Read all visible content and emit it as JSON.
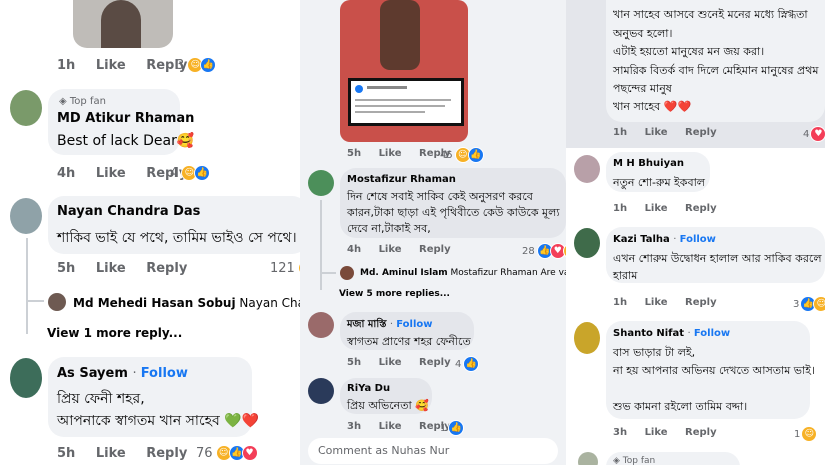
{
  "col1": {
    "top_meta": {
      "time": "1h",
      "like": "Like",
      "reply": "Reply",
      "count": "3"
    },
    "c1": {
      "badge": "Top fan",
      "name": "MD Atikur Rhaman",
      "text": "Best of lack Dear🥰",
      "time": "4h",
      "like": "Like",
      "reply": "Reply",
      "count": "4"
    },
    "c2": {
      "name": "Nayan Chandra Das",
      "text": "শাকিব ভাই যে পথে, তামিম ভাইও সে পথে। 😁",
      "time": "5h",
      "like": "Like",
      "reply": "Reply",
      "count": "121"
    },
    "reply_preview": {
      "name": "Md Mehedi Hasan Sobuj",
      "text": "Nayan Chandra Das y"
    },
    "more_replies": "View 1 more reply...",
    "c3": {
      "name": "As Sayem",
      "follow": "Follow",
      "line1": "প্রিয় ফেনী শহর,",
      "line2": "আপনাকে স্বাগতম খান সাহেব 💚❤️",
      "time": "5h",
      "like": "Like",
      "reply": "Reply",
      "count": "76"
    }
  },
  "col2": {
    "post_meta": {
      "time": "5h",
      "like": "Like",
      "reply": "Reply",
      "count": "45"
    },
    "c1": {
      "name": "Mostafizur Rhaman",
      "line1": "দিন শেষে সবাই সাকিব কেই অনুসরণ করবে",
      "line2": "কারন,টাকা ছাড়া এই পৃথিবীতে কেউ কাউকে মূল্য",
      "line3": "দেবে না,টাকাই সব,",
      "time": "4h",
      "like": "Like",
      "reply": "Reply",
      "count": "28"
    },
    "reply_preview": {
      "name": "Md. Aminul Islam",
      "text": "Mostafizur Rhaman Are vai Tam..."
    },
    "more_replies": "View 5 more replies...",
    "c2": {
      "name": "মজা মাস্তি",
      "follow": "Follow",
      "text": "স্বাগতম প্রাণের শহর ফেনীতে",
      "time": "5h",
      "like": "Like",
      "reply": "Reply",
      "count": "4"
    },
    "c3": {
      "name": "RiYa Du",
      "text": "প্রিয় অভিনেতা 🥰",
      "time": "3h",
      "like": "Like",
      "reply": "Reply",
      "count": "1"
    },
    "comment_placeholder": "Comment as Nuhas Nur"
  },
  "col3": {
    "c0": {
      "line1": "খান সাহেব আসবে শুনেই মনের মধ্যে স্নিগ্ধতা",
      "line2": "অনুভব হলো।",
      "line3": "এটাই হয়তো মানুষের মন জয় করা।",
      "line4": "সামরিক বিতর্ক বাদ দিলে মেহিমান মানুষের প্রথম",
      "line5": "পছন্দের মানুষ",
      "line6": "খান সাহেব ❤️❤️",
      "time": "1h",
      "like": "Like",
      "reply": "Reply",
      "count": "4"
    },
    "c1": {
      "name": "M H Bhuiyan",
      "text": "নতুন শো-রুম ইকবাল",
      "time": "1h",
      "like": "Like",
      "reply": "Reply"
    },
    "c2": {
      "name": "Kazi Talha",
      "follow": "Follow",
      "line1": "এখন শোরুম উদ্বোধন হালাল আর সাকিব করলে",
      "line2": "হারাম",
      "time": "1h",
      "like": "Like",
      "reply": "Reply",
      "count": "3"
    },
    "c3": {
      "name": "Shanto Nifat",
      "follow": "Follow",
      "line1": "বাস ভাড়ার টা লই,",
      "line2": "না হয় আপনার অভিনয় দেখতে আসতাম ভাই।",
      "line3": "শুভ কামনা রইলো তামিম বদ্দা।",
      "time": "3h",
      "like": "Like",
      "reply": "Reply",
      "count": "1"
    },
    "c4": {
      "badge": "Top fan"
    }
  }
}
